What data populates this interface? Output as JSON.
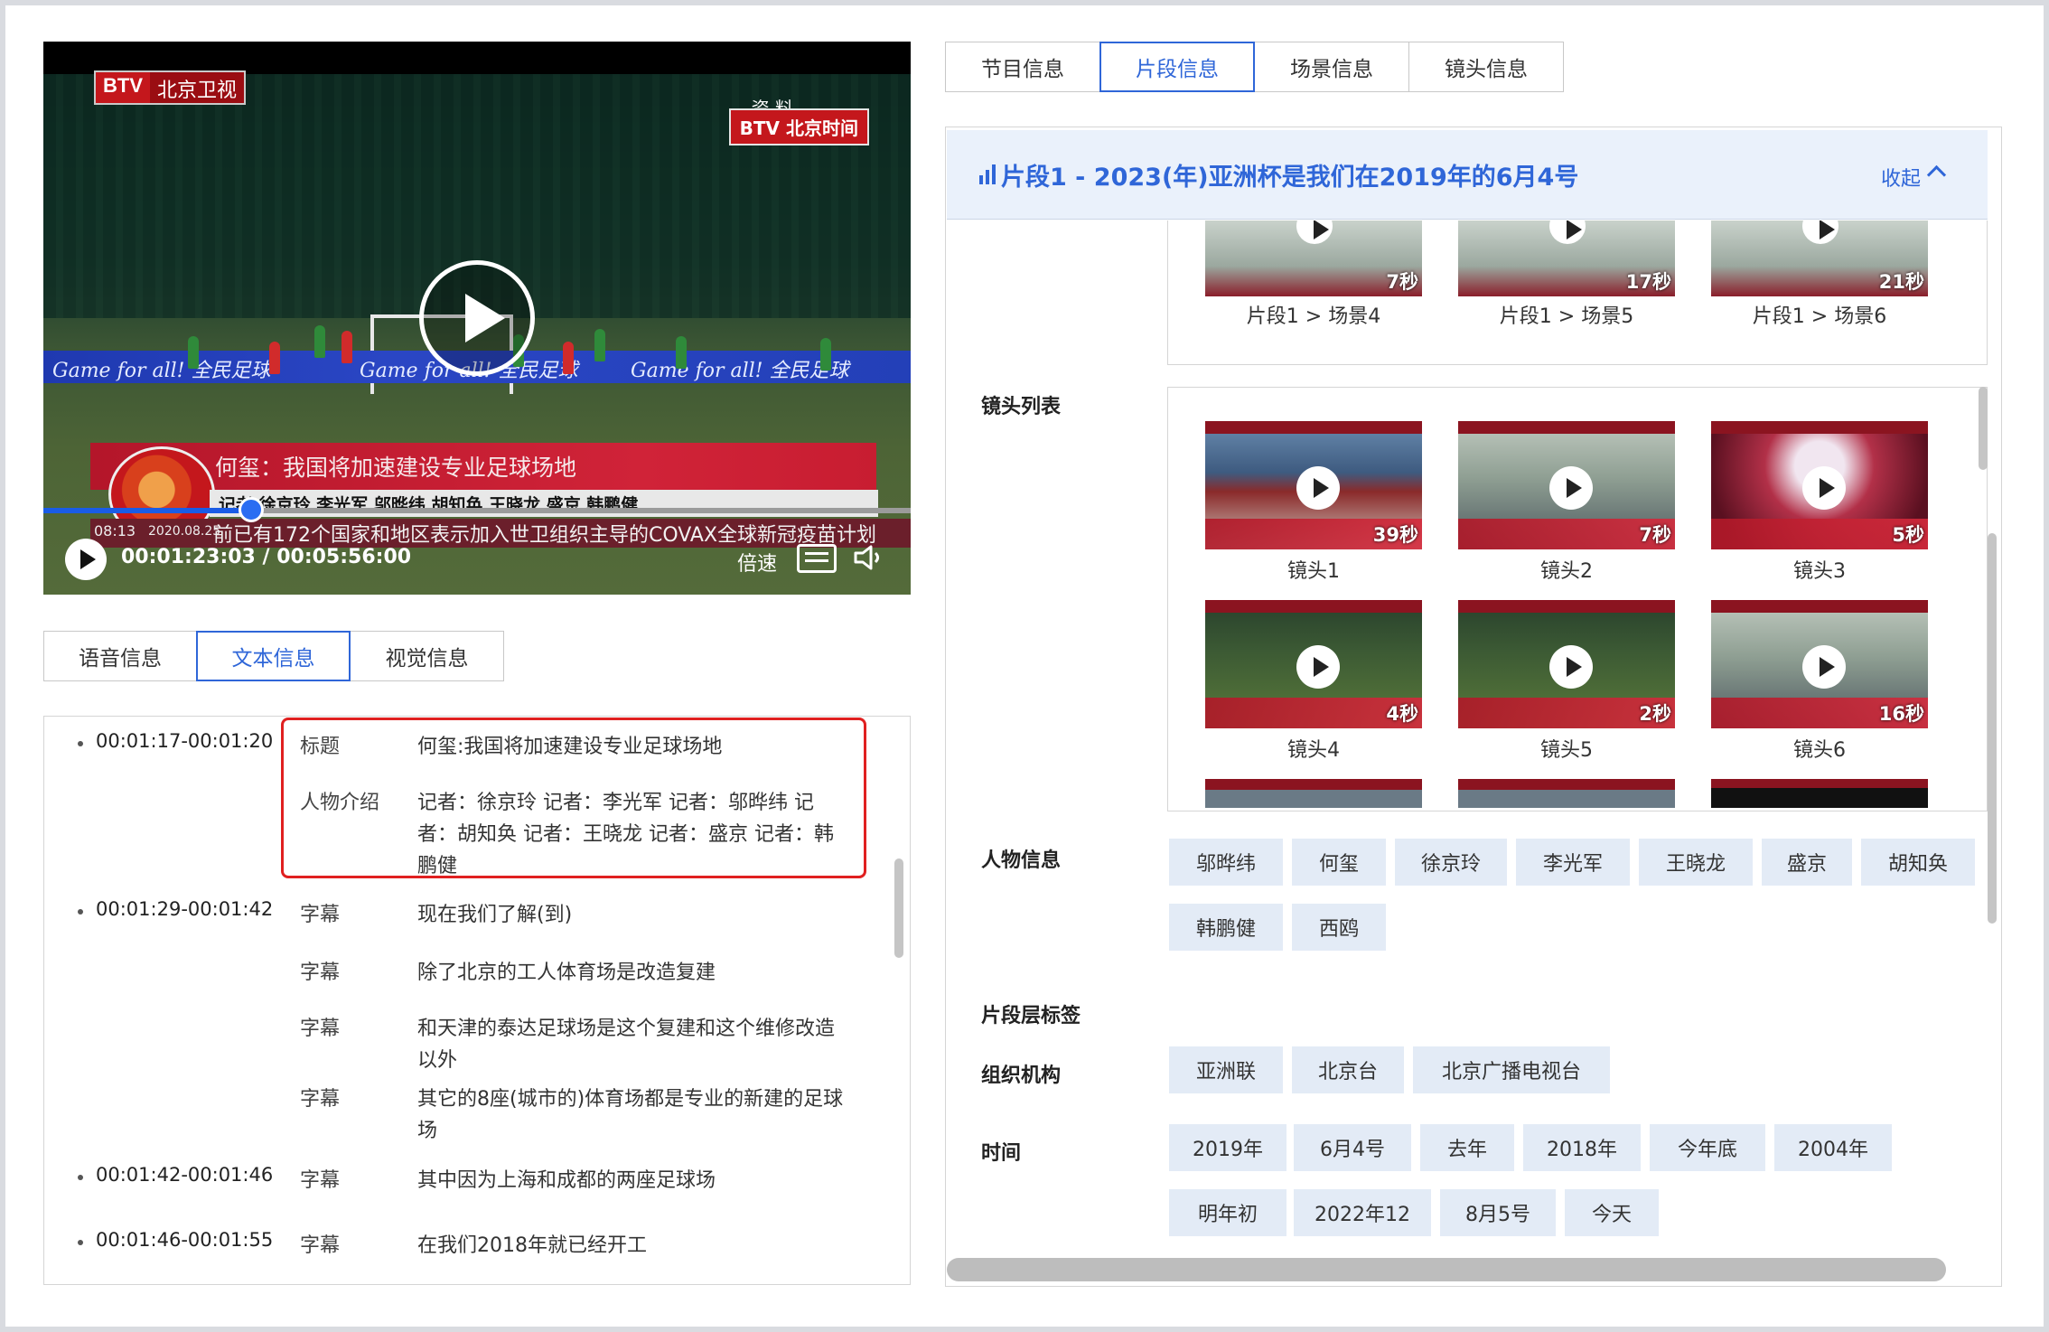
{
  "video": {
    "logo_left_brand": "BTV",
    "logo_left_channel": "北京卫视",
    "logo_right": "BTV 北京时间",
    "archive_label": "资 料",
    "board_slogans": [
      "Game for all!  全民足球",
      "Game for all!  全民足球",
      "Game for all!  全民足球"
    ],
    "caption_title": "何玺：我国将加速建设专业足球场地",
    "caption_names": "记者 徐京玲 李光军 邬晔纬 胡知奂 王晓龙 盛京 韩鹏健",
    "ticker_clock": "08:13",
    "ticker_date": "2020.08.25",
    "ticker_text": "前已有172个国家和地区表示加入世卫组织主导的COVAX全球新冠疫苗计划",
    "current_time": "00:01:23:03",
    "total_time": "00:05:56:00",
    "time_display": "00:01:23:03 / 00:05:56:00",
    "progress_fraction": 0.24,
    "speed_label": "倍速"
  },
  "left_tabs": [
    {
      "label": "语音信息",
      "active": false
    },
    {
      "label": "文本信息",
      "active": true
    },
    {
      "label": "视觉信息",
      "active": false
    }
  ],
  "text_entries": [
    {
      "time": "00:01:17-00:01:20",
      "items": [
        {
          "type": "标题",
          "lines": [
            "何玺:我国将加速建设专业足球场地"
          ]
        },
        {
          "type": "人物介绍",
          "lines": [
            "记者：徐京玲 记者：李光军 记者：邬晔纬 记",
            "者：胡知奂 记者：王晓龙 记者：盛京 记者：韩",
            "鹏健"
          ]
        }
      ]
    },
    {
      "time": "00:01:29-00:01:42",
      "items": [
        {
          "type": "字幕",
          "lines": [
            "现在我们了解(到)"
          ]
        },
        {
          "type": "字幕",
          "lines": [
            "除了北京的工人体育场是改造复建"
          ]
        },
        {
          "type": "字幕",
          "lines": [
            "和天津的泰达足球场是这个复建和这个维修改造",
            "以外"
          ]
        },
        {
          "type": "字幕",
          "lines": [
            "其它的8座(城市的)体育场都是专业的新建的足球",
            "场"
          ]
        }
      ]
    },
    {
      "time": "00:01:42-00:01:46",
      "items": [
        {
          "type": "字幕",
          "lines": [
            "其中因为上海和成都的两座足球场"
          ]
        }
      ]
    },
    {
      "time": "00:01:46-00:01:55",
      "items": [
        {
          "type": "字幕",
          "lines": [
            "在我们2018年就已经开工"
          ]
        }
      ]
    }
  ],
  "right_tabs": [
    {
      "label": "节目信息",
      "active": false
    },
    {
      "label": "片段信息",
      "active": true
    },
    {
      "label": "场景信息",
      "active": false
    },
    {
      "label": "镜头信息",
      "active": false
    }
  ],
  "segment": {
    "title": "片段1 - 2023(年)亚洲杯是我们在2019年的6月4号",
    "collapse_label": "收起"
  },
  "scenes": [
    {
      "caption": "片段1 > 场景4",
      "duration": "7秒"
    },
    {
      "caption": "片段1 > 场景5",
      "duration": "17秒"
    },
    {
      "caption": "片段1 > 场景6",
      "duration": "21秒"
    }
  ],
  "shot_list_label": "镜头列表",
  "shots": [
    {
      "caption": "镜头1",
      "duration": "39秒",
      "kind": "studio"
    },
    {
      "caption": "镜头2",
      "duration": "7秒",
      "kind": "person"
    },
    {
      "caption": "镜头3",
      "duration": "5秒",
      "kind": "fireworks"
    },
    {
      "caption": "镜头4",
      "duration": "4秒",
      "kind": "field"
    },
    {
      "caption": "镜头5",
      "duration": "2秒",
      "kind": "field"
    },
    {
      "caption": "镜头6",
      "duration": "16秒",
      "kind": "person"
    }
  ],
  "people_label": "人物信息",
  "people": [
    "邬晔纬",
    "何玺",
    "徐京玲",
    "李光军",
    "王晓龙",
    "盛京",
    "胡知奂",
    "韩鹏健",
    "西鸥"
  ],
  "segment_tags_label": "片段层标签",
  "org_label": "组织机构",
  "orgs": [
    "亚洲联",
    "北京台",
    "北京广播电视台"
  ],
  "time_label": "时间",
  "times": [
    "2019年",
    "6月4号",
    "去年",
    "2018年",
    "今年底",
    "2004年",
    "明年初",
    "2022年12",
    "8月5号",
    "今天"
  ],
  "colors": {
    "accent": "#2f66d8",
    "tag_bg": "#e3ebf6",
    "highlight": "#e02020"
  }
}
